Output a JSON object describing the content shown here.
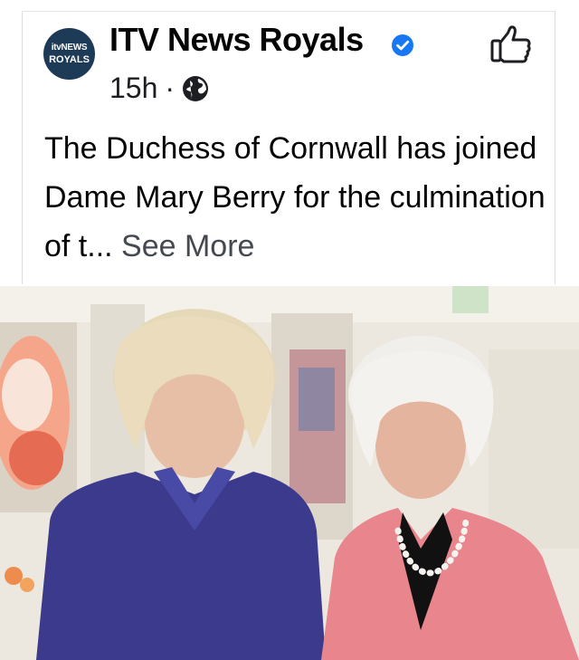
{
  "post": {
    "avatar": {
      "line1": "itvNEWS",
      "line2": "ROYALS"
    },
    "page_name": "ITV News Royals",
    "timestamp": "15h",
    "separator": "·",
    "text": "The Duchess of Cornwall has joined Dame Mary Berry for the culmination of t...",
    "see_more": "See More"
  },
  "icons": {
    "verified": "verified-badge-icon",
    "audience": "globe-icon",
    "like": "thumbs-up-icon"
  },
  "colors": {
    "verified_blue": "#1877f2",
    "avatar_navy": "#1d3a57",
    "jacket_purple": "#3a3a8c",
    "jacket_pink": "#e9878f"
  }
}
